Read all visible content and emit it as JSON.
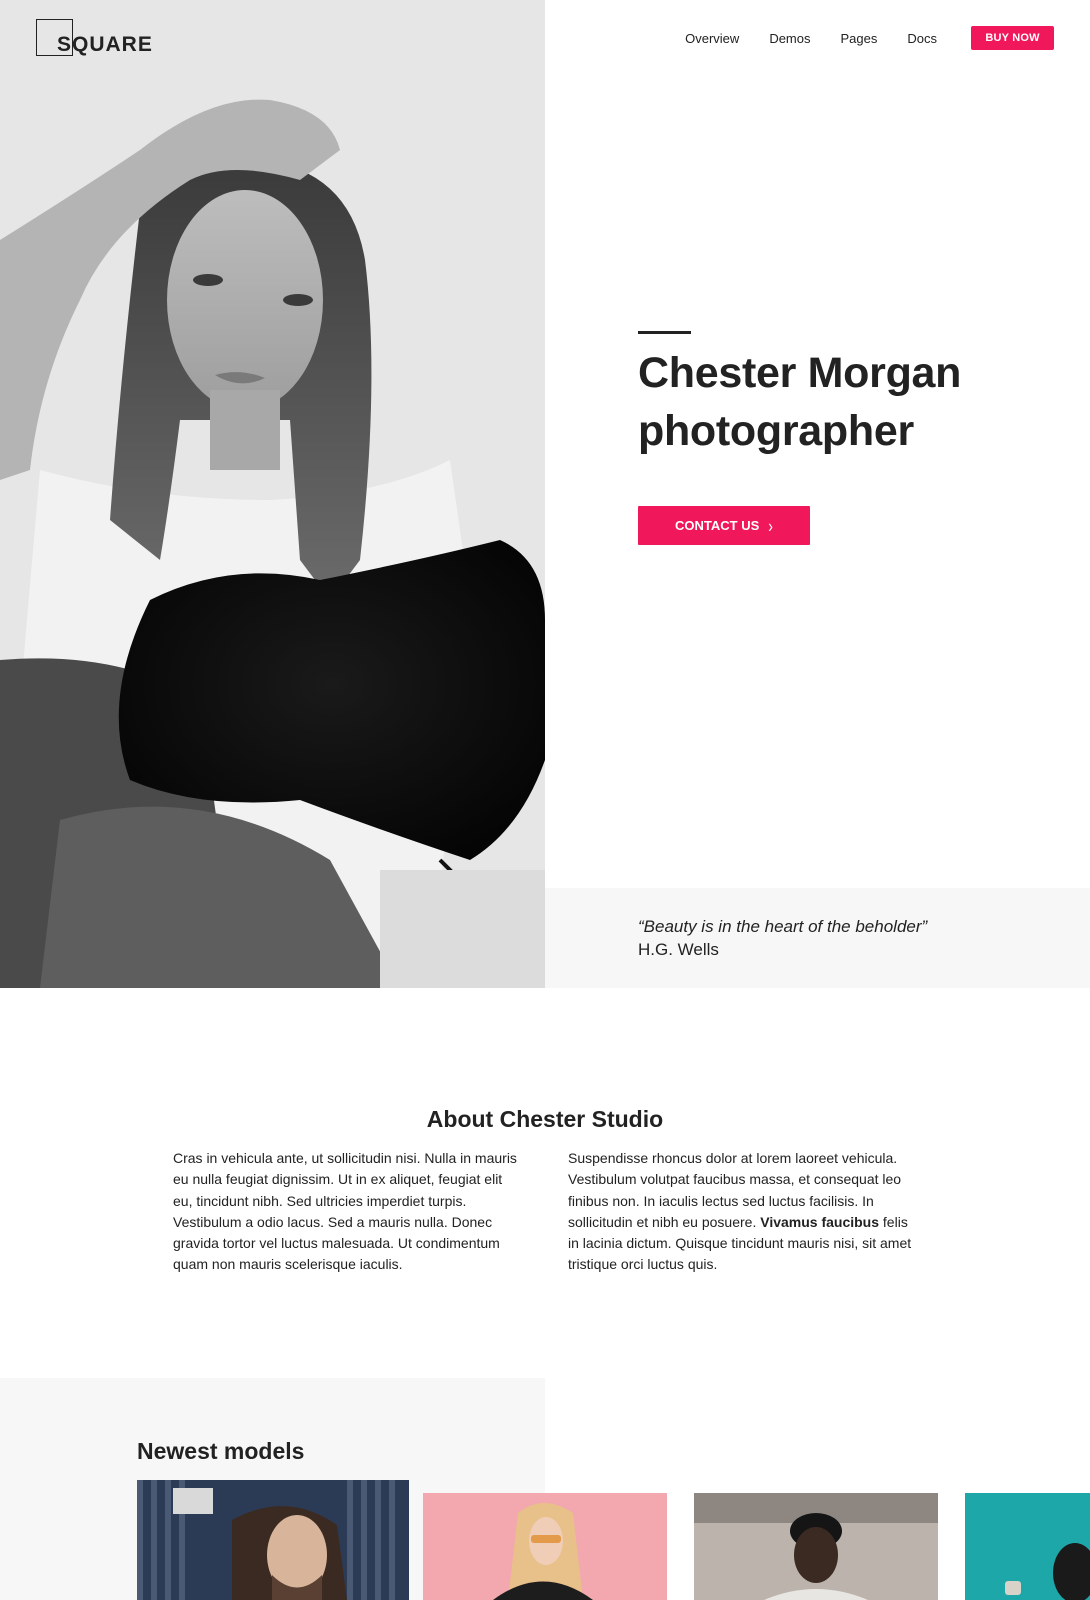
{
  "brand": {
    "logo_text": "SQUARE"
  },
  "nav": {
    "links": [
      "Overview",
      "Demos",
      "Pages",
      "Docs"
    ],
    "buy_label": "BUY NOW"
  },
  "hero": {
    "title_line1": "Chester Morgan",
    "title_line2": "photographer",
    "contact_label": "CONTACT US",
    "contact_icon": "chevron-right-icon"
  },
  "quote": {
    "text": "“Beauty is in the heart of the beholder”",
    "author": "H.G. Wells"
  },
  "about": {
    "title": "About Chester Studio",
    "col1": "Cras in vehicula ante, ut sollicitudin nisi. Nulla in mauris eu nulla feugiat dignissim. Ut in ex aliquet, feugiat elit eu, tincidunt nibh. Sed ultricies imperdiet turpis. Vestibulum a odio lacus. Sed a mauris nulla. Donec gravida tortor vel luctus malesuada. Ut condimentum quam non mauris scelerisque iaculis.",
    "col2_before": "Suspendisse rhoncus dolor at lorem laoreet vehicula. Vestibulum volutpat faucibus massa, et consequat leo finibus non. In iaculis lectus sed luctus facilisis. In sollicitudin et nibh eu posuere.",
    "col2_bold": "Vivamus faucibus",
    "col2_after": "felis in lacinia dictum. Quisque tincidunt mauris nisi, sit amet tristique orci luctus quis."
  },
  "models": {
    "title": "Newest models"
  },
  "colors": {
    "accent": "#f0185a",
    "text": "#222222",
    "band": "#f7f7f7"
  }
}
